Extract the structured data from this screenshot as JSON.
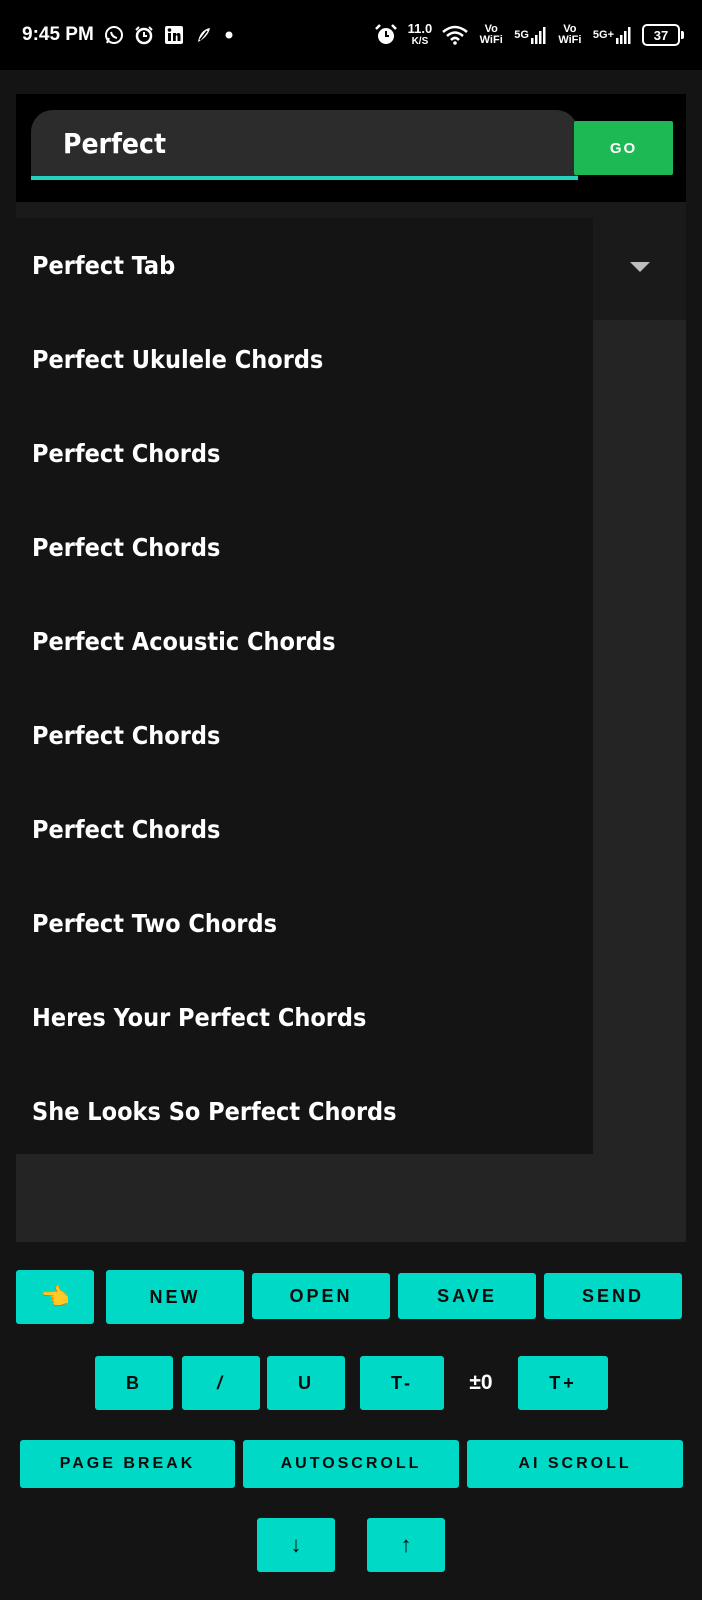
{
  "status_bar": {
    "time": "9:45 PM",
    "net_speed_value": "11.0",
    "net_speed_unit": "K/S",
    "vo_wifi_1": "Vo WiFi",
    "signal_1": "5G",
    "vo_wifi_2": "Vo WiFi",
    "signal_2": "5G+",
    "battery": "37"
  },
  "search": {
    "value": "Perfect",
    "go_label": "GO"
  },
  "suggestions": [
    "Perfect Tab",
    "Perfect Ukulele Chords",
    "Perfect Chords",
    "Perfect Chords",
    "Perfect Acoustic Chords",
    "Perfect Chords",
    "Perfect Chords",
    "Perfect Two Chords",
    "Heres Your Perfect Chords",
    "She Looks So Perfect Chords"
  ],
  "toolbar": {
    "pointer_emoji": "👈",
    "new_label": "NEW",
    "open_label": "OPEN",
    "save_label": "SAVE",
    "send_label": "SEND",
    "bold_label": "B",
    "italic_label": "/",
    "underline_label": "U",
    "transpose_down_label": "T-",
    "transpose_value": "±0",
    "transpose_up_label": "T+",
    "page_break_label": "PAGE BREAK",
    "autoscroll_label": "AUTOSCROLL",
    "ai_scroll_label": "AI SCROLL",
    "down_label": "↓",
    "up_label": "↑"
  },
  "colors": {
    "accent": "#00d9c5",
    "go_button": "#1db954",
    "input_underline": "#22d3c0",
    "background": "#141414"
  },
  "icons": [
    "whatsapp-icon",
    "alarm-icon",
    "linkedin-icon",
    "app-icon",
    "wifi-icon",
    "signal-icon",
    "battery-icon",
    "dropdown-arrow-icon"
  ]
}
